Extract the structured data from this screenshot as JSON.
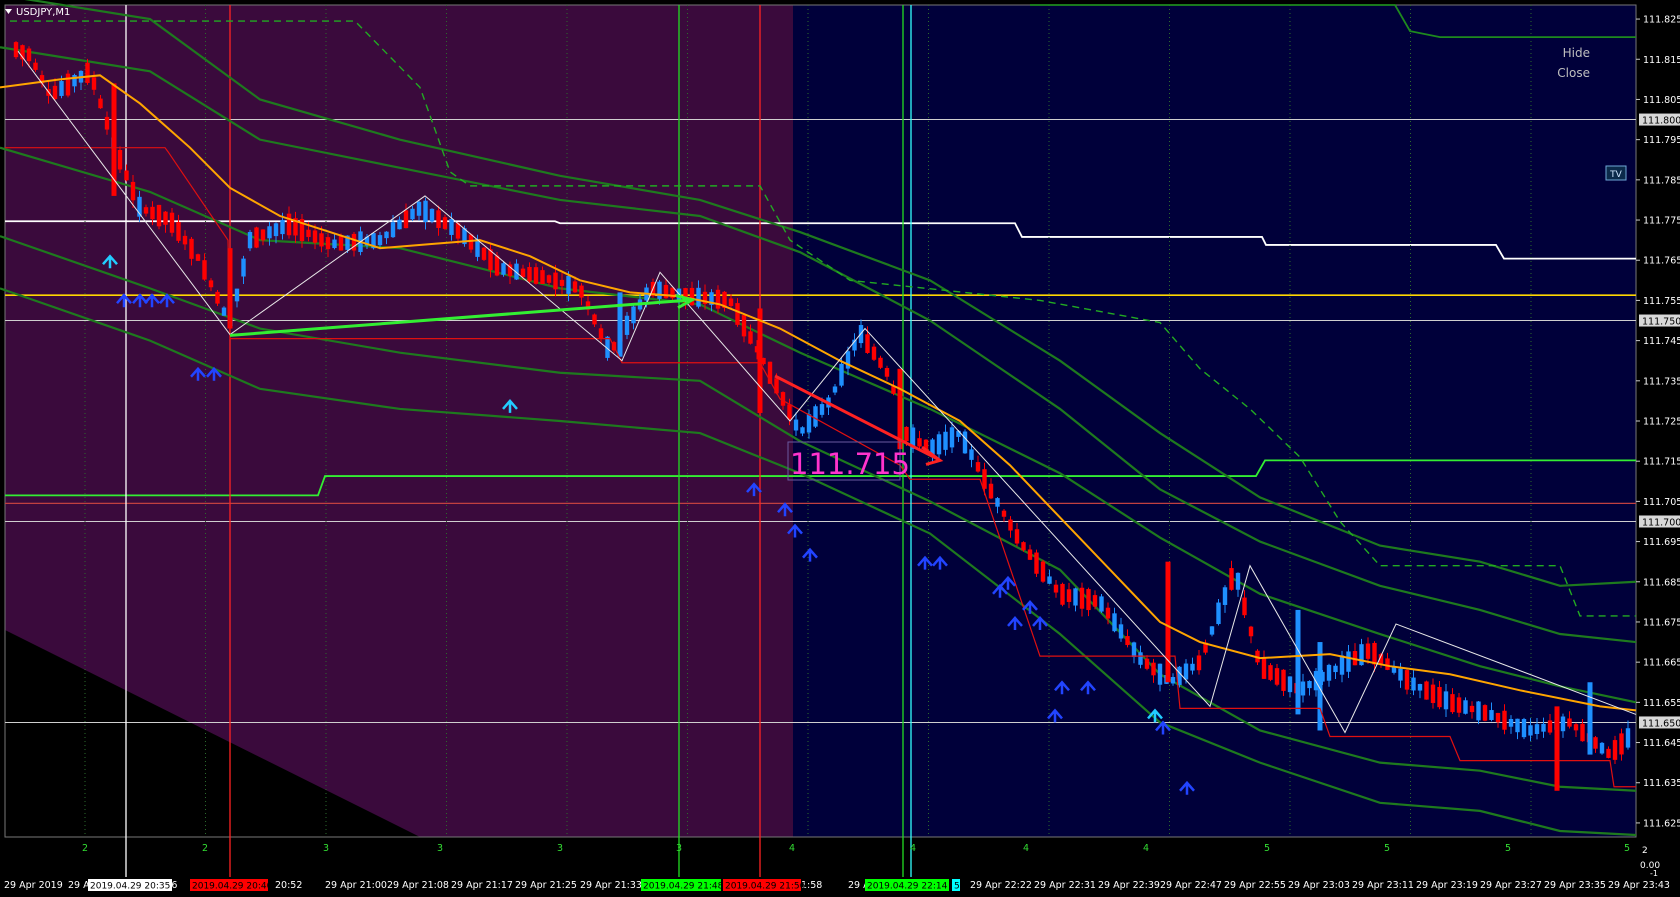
{
  "window": {
    "title": "USDJPY,M1"
  },
  "panel": {
    "hide": "Hide",
    "close": "Close",
    "tv": "TV"
  },
  "price_label": "111.715",
  "y_axis": {
    "ticks": [
      "111.825",
      "111.815",
      "111.805",
      "111.795",
      "111.785",
      "111.775",
      "111.765",
      "111.755",
      "111.745",
      "111.735",
      "111.725",
      "111.715",
      "111.705",
      "111.695",
      "111.685",
      "111.675",
      "111.665",
      "111.655",
      "111.645",
      "111.635",
      "111.625"
    ],
    "ticks_values": [
      111.825,
      111.815,
      111.805,
      111.795,
      111.785,
      111.775,
      111.765,
      111.755,
      111.745,
      111.735,
      111.725,
      111.715,
      111.705,
      111.695,
      111.685,
      111.675,
      111.665,
      111.655,
      111.645,
      111.635,
      111.625
    ],
    "boxed": [
      {
        "text": "111.800",
        "value": 111.8
      },
      {
        "text": "111.750",
        "value": 111.75
      },
      {
        "text": "111.700",
        "value": 111.7
      },
      {
        "text": "111.650",
        "value": 111.65
      }
    ]
  },
  "sub_axis": {
    "top": "2",
    "bottom": "0.00",
    "minus": "-1"
  },
  "x_axis": {
    "labels": [
      "29 Apr 2019",
      "29 A",
      "20:36",
      "20:52",
      "29 Apr 21:00",
      "29 Apr 21:08",
      "29 Apr 21:17",
      "29 Apr 21:25",
      "29 Apr 21:33",
      "r 21:58",
      "29 Apr",
      "29 Apr 22:22",
      "29 Apr 22:31",
      "29 Apr 22:39",
      "29 Apr 22:47",
      "29 Apr 22:55",
      "29 Apr 23:03",
      "29 Apr 23:11",
      "29 Apr 23:19",
      "29 Apr 23:27",
      "29 Apr 23:35",
      "29 Apr 23:43"
    ],
    "markers": [
      {
        "text": "2019.04.29 20:35",
        "color": "#ffffff",
        "textColor": "#000000"
      },
      {
        "text": "2019.04.29 20:40",
        "color": "#ff0000",
        "textColor": "#000000"
      },
      {
        "text": "2019.04.29 21:48",
        "color": "#00ff00",
        "textColor": "#000000"
      },
      {
        "text": "2019.04.29 21:56",
        "color": "#ff0000",
        "textColor": "#000000"
      },
      {
        "text": "2019.04.29 22:14",
        "color": "#00ff00",
        "textColor": "#000000"
      },
      {
        "text": "5",
        "color": "#00ffff",
        "textColor": "#000000"
      }
    ]
  },
  "session_numbers": [
    "2",
    "2",
    "3",
    "3",
    "3",
    "3",
    "4",
    "4",
    "4",
    "4",
    "5",
    "5",
    "5",
    "5"
  ],
  "colors": {
    "background": "#000000",
    "zone_purple": "#3a0a3c",
    "zone_navy": "#00003a",
    "bull": "#1e90ff",
    "bear": "#ff0000",
    "ma": "#ffa500",
    "channel": "#1e7a1e",
    "level_yellow": "#ffd700",
    "level_white": "#ffffff",
    "level_green": "#33ee33",
    "label_magenta": "#ff33cc"
  }
}
